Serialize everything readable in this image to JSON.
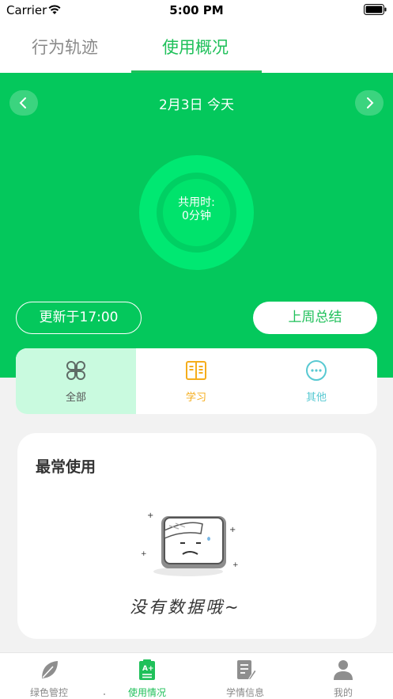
{
  "status_bar": {
    "carrier": "Carrier",
    "time": "5:00 PM"
  },
  "tabs": [
    {
      "label": "行为轨迹",
      "active": false
    },
    {
      "label": "使用概况",
      "active": true
    }
  ],
  "date_nav": {
    "date": "2月3日",
    "relative": "今天",
    "title": "2月3日 今天"
  },
  "usage_ring": {
    "line1": "共用时:",
    "line2": "0分钟"
  },
  "buttons": {
    "updated": "更新于17:00",
    "last_week_summary": "上周总结"
  },
  "categories": [
    {
      "label": "全部",
      "icon": "grid-icon",
      "selected": true
    },
    {
      "label": "学习",
      "icon": "book-icon",
      "selected": false
    },
    {
      "label": "其他",
      "icon": "more-icon",
      "selected": false
    }
  ],
  "most_used": {
    "title": "最常使用",
    "empty_text": "没有数据哦~"
  },
  "bottom_nav": [
    {
      "label": "绿色管控",
      "icon": "leaf-icon",
      "active": false
    },
    {
      "label": "使用情况",
      "icon": "clipboard-icon",
      "active": true
    },
    {
      "label": "学情信息",
      "icon": "document-edit-icon",
      "active": false
    },
    {
      "label": "我的",
      "icon": "person-icon",
      "active": false
    }
  ],
  "colors": {
    "brand_green": "#04c85c",
    "active_text": "#1fc05a",
    "study_orange": "#f5ad1c",
    "other_cyan": "#58c9d2",
    "selected_category_bg": "#c9fadf"
  }
}
